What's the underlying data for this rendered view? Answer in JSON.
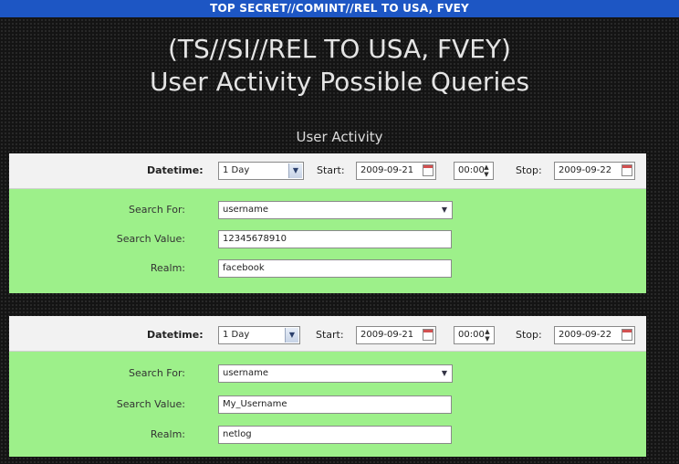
{
  "banner": "TOP SECRET//COMINT//REL TO USA, FVEY",
  "title_line1": "(TS//SI//REL TO USA, FVEY)",
  "title_line2": "User Activity Possible Queries",
  "section_title": "User Activity",
  "colors": {
    "banner": "#1d56c4",
    "form_bg": "#9df08a",
    "datetime_bg": "#f2f2f2"
  },
  "panels": [
    {
      "datetime_label": "Datetime:",
      "duration": "1 Day",
      "start_label": "Start:",
      "start_date": "2009-09-21",
      "time": "00:00",
      "stop_label": "Stop:",
      "stop_date": "2009-09-22",
      "search_for_label": "Search For:",
      "search_for": "username",
      "search_value_label": "Search Value:",
      "search_value": "12345678910",
      "realm_label": "Realm:",
      "realm": "facebook"
    },
    {
      "datetime_label": "Datetime:",
      "duration": "1 Day",
      "start_label": "Start:",
      "start_date": "2009-09-21",
      "time": "00:00",
      "stop_label": "Stop:",
      "stop_date": "2009-09-22",
      "search_for_label": "Search For:",
      "search_for": "username",
      "search_value_label": "Search Value:",
      "search_value": "My_Username",
      "realm_label": "Realm:",
      "realm": "netlog"
    }
  ]
}
